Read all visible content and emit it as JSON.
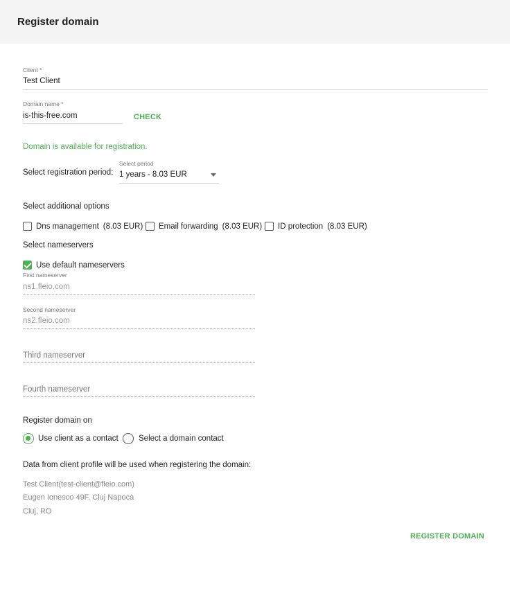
{
  "header": {
    "title": "Register domain"
  },
  "client": {
    "label": "Client *",
    "value": "Test Client"
  },
  "domain": {
    "label": "Domain name *",
    "value": "is-this-free.com",
    "check_label": "CHECK"
  },
  "availability": {
    "message": "Domain is available for registration."
  },
  "period": {
    "label": "Select registration period:",
    "field_label": "Select period",
    "selected": "1 years - 8.03 EUR"
  },
  "options": {
    "title": "Select additional options",
    "items": [
      {
        "label": "Dns management",
        "price": "(8.03 EUR)",
        "checked": false
      },
      {
        "label": "Email forwarding",
        "price": "(8.03 EUR)",
        "checked": false
      },
      {
        "label": "ID protection",
        "price": "(8.03 EUR)",
        "checked": false
      }
    ]
  },
  "nameservers": {
    "title": "Select nameservers",
    "use_default_label": "Use default nameservers",
    "use_default_checked": true,
    "first": {
      "label": "First nameserver",
      "value": "ns1.fleio.com"
    },
    "second": {
      "label": "Second nameserver",
      "value": "ns2.fleio.com"
    },
    "third": {
      "placeholder": "Third nameserver"
    },
    "fourth": {
      "placeholder": "Fourth nameserver"
    }
  },
  "register_on": {
    "title": "Register domain on",
    "options": [
      {
        "label": "Use client as a contact",
        "selected": true
      },
      {
        "label": "Select a domain contact",
        "selected": false
      }
    ]
  },
  "profile": {
    "title": "Data from client profile will be used when registering the domain:",
    "lines": [
      "Test Client(test-client@fleio.com)",
      "Eugen Ionesco 49F, Cluj Napoca",
      "Cluj, RO"
    ]
  },
  "actions": {
    "register_label": "REGISTER DOMAIN"
  },
  "colors": {
    "accent": "#4caf50",
    "header_bg": "#f4f4f4"
  },
  "icons": {
    "dropdown": "caret-down-icon",
    "checkmark": "checkmark-icon"
  }
}
